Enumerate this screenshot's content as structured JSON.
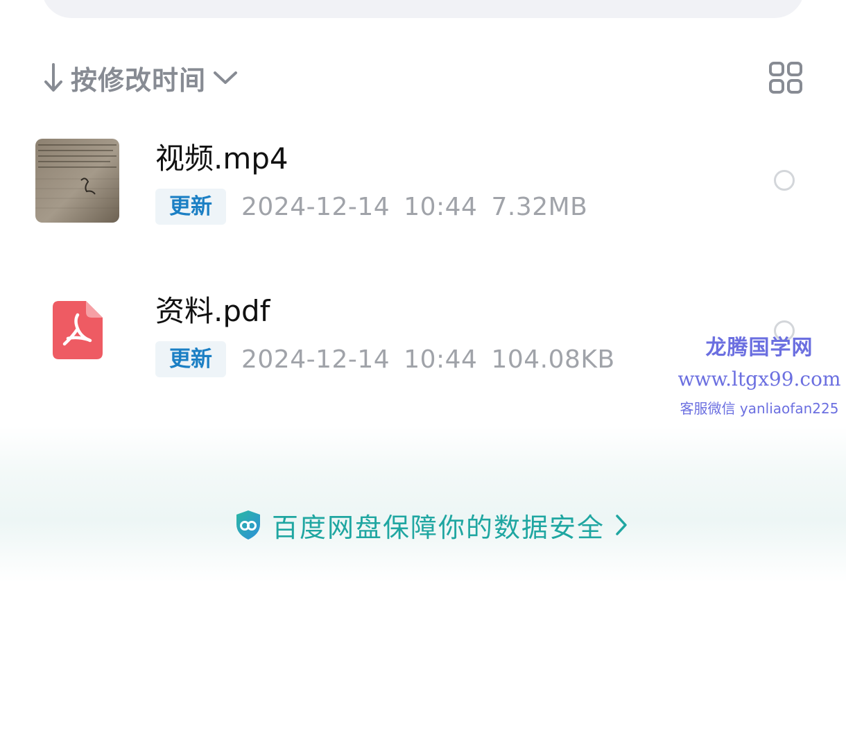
{
  "sort": {
    "label": "按修改时间"
  },
  "files": [
    {
      "name": "视频.mp4",
      "badge": "更新",
      "date": "2024-12-14",
      "time": "10:44",
      "size": "7.32MB",
      "icon": "video-thumbnail"
    },
    {
      "name": "资料.pdf",
      "badge": "更新",
      "date": "2024-12-14",
      "time": "10:44",
      "size": "104.08KB",
      "icon": "pdf-icon"
    }
  ],
  "security": {
    "text": "百度网盘保障你的数据安全"
  },
  "watermark": {
    "title": "龙腾国学网",
    "url": "www.ltgx99.com",
    "contact": "客服微信 yanliaofan225"
  },
  "colors": {
    "accent": "#1fa6a1",
    "badge_text": "#1b7fc4",
    "pdf_red": "#ee5b63",
    "watermark": "#6b6fe0"
  }
}
